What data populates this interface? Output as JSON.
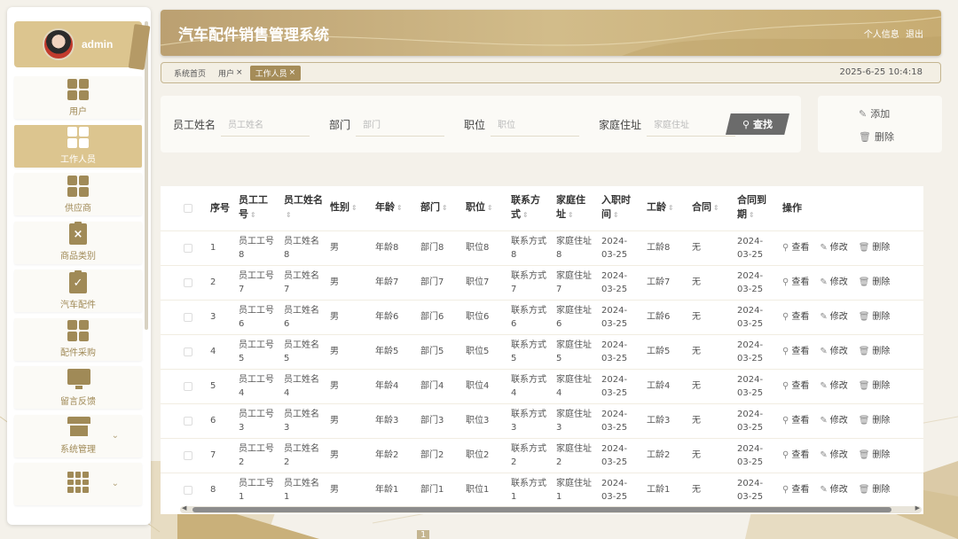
{
  "user": {
    "name": "admin"
  },
  "sidebar": {
    "items": [
      {
        "label": "用户",
        "icon": "grid-icon",
        "active": false
      },
      {
        "label": "工作人员",
        "icon": "grid-icon",
        "active": true
      },
      {
        "label": "供应商",
        "icon": "grid-icon",
        "active": false
      },
      {
        "label": "商品类别",
        "icon": "clipboard-x-icon",
        "active": false
      },
      {
        "label": "汽车配件",
        "icon": "clipboard-check-icon",
        "active": false
      },
      {
        "label": "配件采购",
        "icon": "grid-icon",
        "active": false
      },
      {
        "label": "留言反馈",
        "icon": "monitor-icon",
        "active": false
      },
      {
        "label": "系统管理",
        "icon": "shop-icon",
        "active": false,
        "expandable": true
      },
      {
        "label": "",
        "icon": "grid9-icon",
        "active": false,
        "expandable": true
      }
    ]
  },
  "header": {
    "title": "汽车配件销售管理系统",
    "profile_link": "个人信息",
    "logout_link": "退出"
  },
  "tabs": {
    "items": [
      {
        "label": "系统首页",
        "closable": false,
        "active": false
      },
      {
        "label": "用户",
        "closable": true,
        "active": false
      },
      {
        "label": "工作人员",
        "closable": true,
        "active": true
      }
    ],
    "close_symbol": "×",
    "datetime": "2025-6-25 10:4:18"
  },
  "search": {
    "fields": [
      {
        "label": "员工姓名",
        "placeholder": "员工姓名"
      },
      {
        "label": "部门",
        "placeholder": "部门"
      },
      {
        "label": "职位",
        "placeholder": "职位"
      },
      {
        "label": "家庭住址",
        "placeholder": "家庭住址"
      }
    ],
    "button_label": "查找"
  },
  "actions": {
    "add_label": "添加",
    "delete_label": "删除"
  },
  "table": {
    "headers": [
      "序号",
      "员工工号",
      "员工姓名",
      "性别",
      "年龄",
      "部门",
      "职位",
      "联系方式",
      "家庭住址",
      "入职时间",
      "工龄",
      "合同",
      "合同到期",
      "操作"
    ],
    "row_actions": {
      "view": "查看",
      "edit": "修改",
      "delete": "删除"
    },
    "rows": [
      [
        "1",
        "员工工号8",
        "员工姓名8",
        "男",
        "年龄8",
        "部门8",
        "职位8",
        "联系方式8",
        "家庭住址8",
        "2024-03-25",
        "工龄8",
        "无",
        "2024-03-25"
      ],
      [
        "2",
        "员工工号7",
        "员工姓名7",
        "男",
        "年龄7",
        "部门7",
        "职位7",
        "联系方式7",
        "家庭住址7",
        "2024-03-25",
        "工龄7",
        "无",
        "2024-03-25"
      ],
      [
        "3",
        "员工工号6",
        "员工姓名6",
        "男",
        "年龄6",
        "部门6",
        "职位6",
        "联系方式6",
        "家庭住址6",
        "2024-03-25",
        "工龄6",
        "无",
        "2024-03-25"
      ],
      [
        "4",
        "员工工号5",
        "员工姓名5",
        "男",
        "年龄5",
        "部门5",
        "职位5",
        "联系方式5",
        "家庭住址5",
        "2024-03-25",
        "工龄5",
        "无",
        "2024-03-25"
      ],
      [
        "5",
        "员工工号4",
        "员工姓名4",
        "男",
        "年龄4",
        "部门4",
        "职位4",
        "联系方式4",
        "家庭住址4",
        "2024-03-25",
        "工龄4",
        "无",
        "2024-03-25"
      ],
      [
        "6",
        "员工工号3",
        "员工姓名3",
        "男",
        "年龄3",
        "部门3",
        "职位3",
        "联系方式3",
        "家庭住址3",
        "2024-03-25",
        "工龄3",
        "无",
        "2024-03-25"
      ],
      [
        "7",
        "员工工号2",
        "员工姓名2",
        "男",
        "年龄2",
        "部门2",
        "职位2",
        "联系方式2",
        "家庭住址2",
        "2024-03-25",
        "工龄2",
        "无",
        "2024-03-25"
      ],
      [
        "8",
        "员工工号1",
        "员工姓名1",
        "男",
        "年龄1",
        "部门1",
        "职位1",
        "联系方式1",
        "家庭住址1",
        "2024-03-25",
        "工龄1",
        "无",
        "2024-03-25"
      ]
    ]
  },
  "pager": {
    "current_page": "1"
  },
  "colors": {
    "accent": "#dcc58f",
    "accent_dark": "#a58c58",
    "header_gradient_start": "#bba071",
    "header_gradient_end": "#c7ac72"
  }
}
